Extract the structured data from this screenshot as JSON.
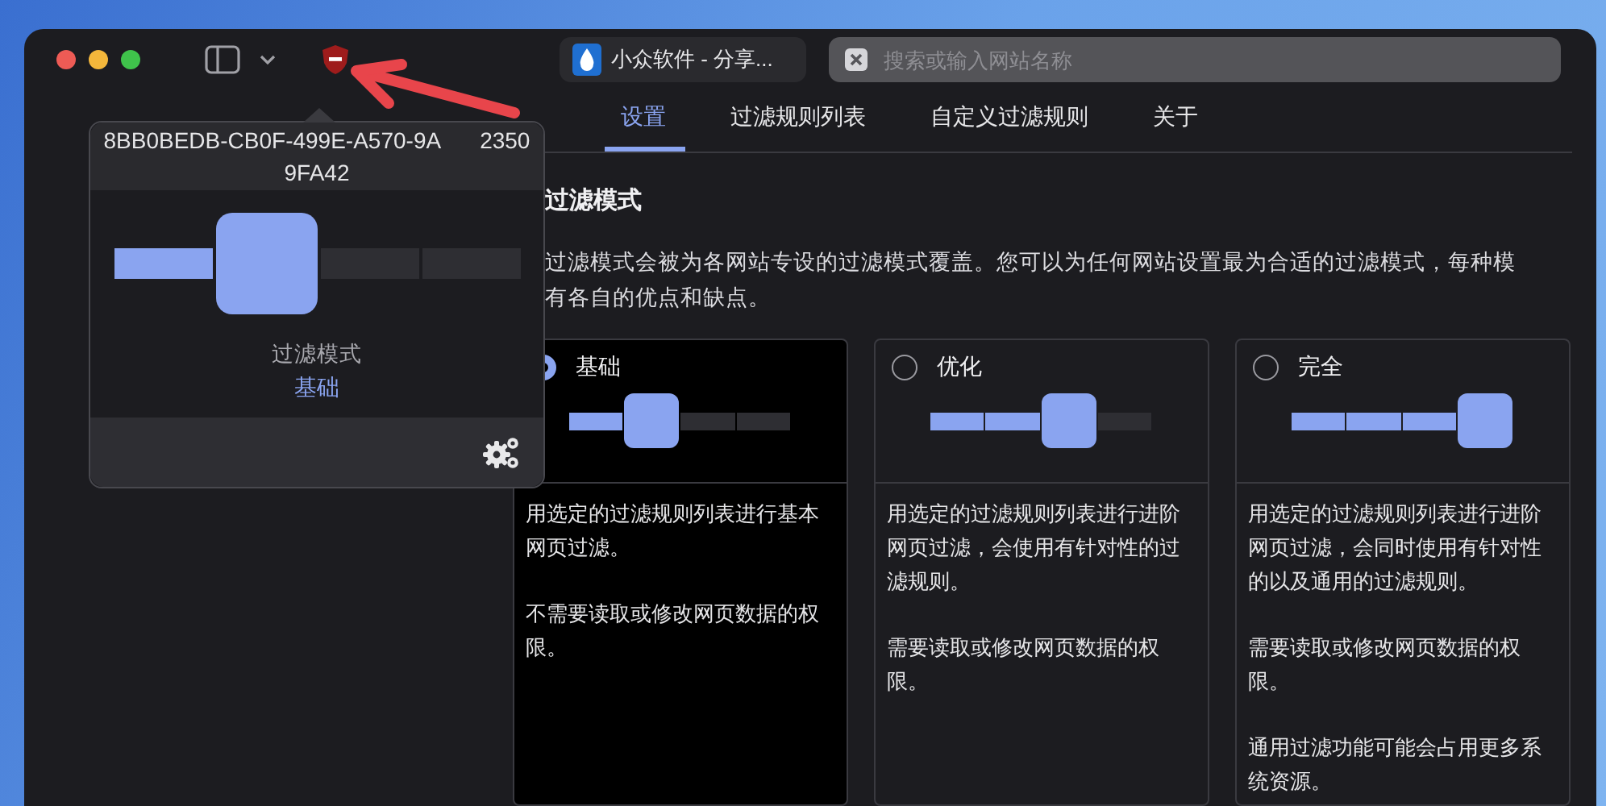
{
  "toolbar": {
    "tab_title": "小众软件 - 分享...",
    "search": {
      "placeholder": "搜索或输入网站名称"
    }
  },
  "popover": {
    "id_parts": [
      "8BB0BEDB-CB0F-499E-A570-9A",
      "2350"
    ],
    "id_line2": "9FA42",
    "slider": {
      "level": 0.333
    },
    "mode_label": "过滤模式",
    "mode_value": "基础"
  },
  "tabs": [
    {
      "label": "设置",
      "selected": true
    },
    {
      "label": "过滤规则列表",
      "selected": false
    },
    {
      "label": "自定义过滤规则",
      "selected": false
    },
    {
      "label": "关于",
      "selected": false
    }
  ],
  "section": {
    "heading": "过滤模式",
    "description_lines": [
      "过滤模式会被为各网站专设的过滤模式覆盖。您可以为任何网站设置最为合适的过滤模式，每种模",
      "有各自的优点和缺点。"
    ]
  },
  "modes": [
    {
      "title": "基础",
      "selected": true,
      "level": 0.333,
      "paragraphs": [
        "用选定的过滤规则列表进行基本网页过滤。",
        "不需要读取或修改网页数据的权限。"
      ]
    },
    {
      "title": "优化",
      "selected": false,
      "level": 0.667,
      "paragraphs": [
        "用选定的过滤规则列表进行进阶网页过滤，会使用有针对性的过滤规则。",
        "需要读取或修改网页数据的权限。"
      ]
    },
    {
      "title": "完全",
      "selected": false,
      "level": 1,
      "paragraphs": [
        "用选定的过滤规则列表进行进阶网页过滤，会同时使用有针对性的以及通用的过滤规则。",
        "需要读取或修改网页数据的权限。",
        "通用过滤功能可能会占用更多系统资源。"
      ]
    }
  ]
}
